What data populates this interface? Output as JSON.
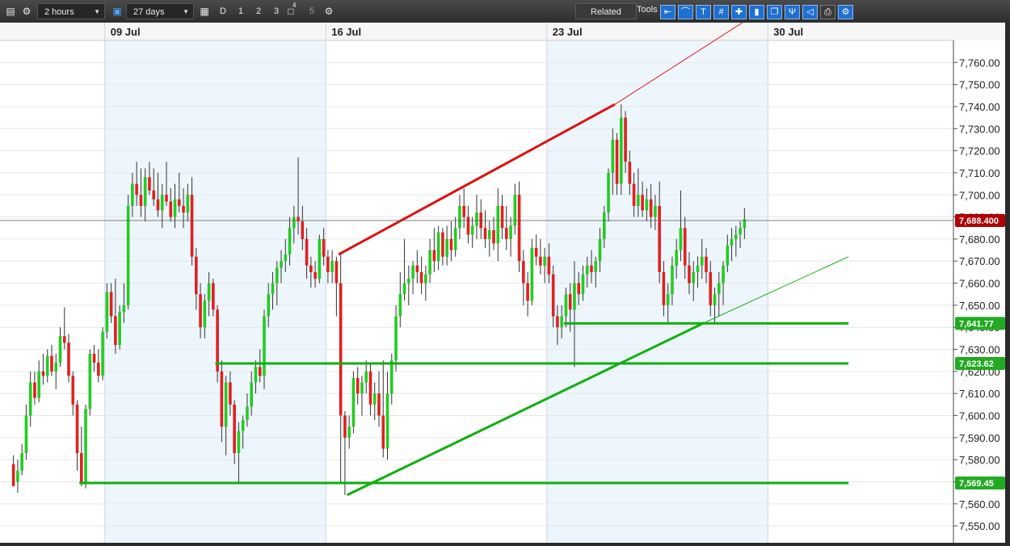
{
  "toolbar": {
    "interval": "2 hours",
    "range": "27 days",
    "period_buttons": [
      "D",
      "1",
      "2",
      "3"
    ],
    "badge": "4",
    "period_extra": "5",
    "related_label": "Related",
    "tools_label": "Tools",
    "icons": [
      "list-icon",
      "gear-icon",
      "lock-icon",
      "calendar-icon",
      "layers-icon",
      "settings-icon"
    ],
    "tool_icons": [
      "arrow-left-icon",
      "curve-icon",
      "text-icon",
      "grid-icon",
      "crosshair-icon",
      "candle-icon",
      "copy-icon",
      "pitchfork-icon",
      "label-icon",
      "print-icon",
      "settings-link-icon"
    ]
  },
  "chart_data": {
    "type": "candlestick",
    "ylim": [
      7542,
      7770
    ],
    "x_range_bars": [
      0,
      192
    ],
    "date_labels": [
      {
        "bar": 22,
        "label": "09 Jul"
      },
      {
        "bar": 74,
        "label": "16 Jul"
      },
      {
        "bar": 126,
        "label": "23 Jul"
      },
      {
        "bar": 178,
        "label": "30 Jul"
      }
    ],
    "y_ticks": [
      7550,
      7560,
      7570,
      7580,
      7590,
      7600,
      7610,
      7620,
      7630,
      7640,
      7650,
      7660,
      7670,
      7680,
      7690,
      7700,
      7710,
      7720,
      7730,
      7740,
      7750,
      7760
    ],
    "price_tags": [
      {
        "value": 7688.4,
        "label": "7,688.400",
        "color": "#b00000"
      },
      {
        "value": 7641.77,
        "label": "7,641.77",
        "color": "#22aa22"
      },
      {
        "value": 7623.62,
        "label": "7,623.62",
        "color": "#22aa22"
      },
      {
        "value": 7569.45,
        "label": "7,569.45",
        "color": "#22aa22"
      }
    ],
    "trendlines": [
      {
        "color": "#e01010",
        "from": [
          77,
          7673
        ],
        "to": [
          142,
          7741
        ],
        "extend_to": [
          172,
          7778
        ]
      },
      {
        "color": "#10b010",
        "from": [
          79,
          7564
        ],
        "to": [
          163,
          7642
        ],
        "extend_to": [
          197,
          7672
        ]
      },
      {
        "color": "#10b010",
        "from": [
          16,
          7569.45
        ],
        "to": [
          197,
          7569.45
        ]
      },
      {
        "color": "#10b010",
        "from": [
          48,
          7623.62
        ],
        "to": [
          197,
          7623.62
        ]
      },
      {
        "color": "#10b010",
        "from": [
          130,
          7641.77
        ],
        "to": [
          197,
          7641.77
        ]
      }
    ],
    "colors": {
      "up": "#22cc22",
      "down": "#e02020",
      "shade": "#eef6fd"
    },
    "candles": [
      [
        7578,
        7582,
        7570,
        7568
      ],
      [
        7570,
        7580,
        7565,
        7575
      ],
      [
        7575,
        7587,
        7573,
        7583
      ],
      [
        7583,
        7605,
        7580,
        7600
      ],
      [
        7600,
        7620,
        7595,
        7615
      ],
      [
        7615,
        7620,
        7605,
        7608
      ],
      [
        7608,
        7625,
        7606,
        7620
      ],
      [
        7620,
        7628,
        7614,
        7618
      ],
      [
        7618,
        7630,
        7615,
        7627
      ],
      [
        7627,
        7632,
        7618,
        7620
      ],
      [
        7620,
        7628,
        7612,
        7624
      ],
      [
        7624,
        7640,
        7622,
        7636
      ],
      [
        7636,
        7649,
        7630,
        7633
      ],
      [
        7633,
        7637,
        7615,
        7618
      ],
      [
        7618,
        7620,
        7600,
        7605
      ],
      [
        7605,
        7607,
        7575,
        7583
      ],
      [
        7583,
        7595,
        7568,
        7570
      ],
      [
        7570,
        7605,
        7567,
        7603
      ],
      [
        7603,
        7630,
        7600,
        7628
      ],
      [
        7628,
        7632,
        7620,
        7624
      ],
      [
        7624,
        7630,
        7615,
        7618
      ],
      [
        7618,
        7640,
        7616,
        7638
      ],
      [
        7638,
        7660,
        7635,
        7656
      ],
      [
        7656,
        7660,
        7642,
        7645
      ],
      [
        7645,
        7662,
        7628,
        7632
      ],
      [
        7632,
        7650,
        7630,
        7647
      ],
      [
        7647,
        7660,
        7642,
        7650
      ],
      [
        7650,
        7700,
        7648,
        7695
      ],
      [
        7695,
        7710,
        7690,
        7705
      ],
      [
        7705,
        7715,
        7695,
        7700
      ],
      [
        7700,
        7712,
        7690,
        7695
      ],
      [
        7695,
        7712,
        7688,
        7708
      ],
      [
        7708,
        7715,
        7700,
        7702
      ],
      [
        7702,
        7712,
        7695,
        7698
      ],
      [
        7698,
        7710,
        7690,
        7693
      ],
      [
        7693,
        7705,
        7685,
        7700
      ],
      [
        7700,
        7715,
        7695,
        7697
      ],
      [
        7697,
        7703,
        7688,
        7690
      ],
      [
        7690,
        7705,
        7685,
        7698
      ],
      [
        7698,
        7710,
        7692,
        7695
      ],
      [
        7695,
        7703,
        7685,
        7692
      ],
      [
        7692,
        7705,
        7688,
        7700
      ],
      [
        7700,
        7708,
        7668,
        7672
      ],
      [
        7672,
        7676,
        7648,
        7655
      ],
      [
        7655,
        7660,
        7635,
        7640
      ],
      [
        7640,
        7655,
        7635,
        7652
      ],
      [
        7652,
        7665,
        7645,
        7660
      ],
      [
        7660,
        7662,
        7645,
        7648
      ],
      [
        7648,
        7650,
        7615,
        7620
      ],
      [
        7620,
        7625,
        7588,
        7595
      ],
      [
        7595,
        7618,
        7582,
        7615
      ],
      [
        7615,
        7620,
        7600,
        7605
      ],
      [
        7605,
        7607,
        7578,
        7583
      ],
      [
        7583,
        7597,
        7569,
        7593
      ],
      [
        7593,
        7600,
        7585,
        7598
      ],
      [
        7598,
        7610,
        7595,
        7604
      ],
      [
        7604,
        7620,
        7600,
        7615
      ],
      [
        7615,
        7625,
        7610,
        7622
      ],
      [
        7622,
        7630,
        7615,
        7618
      ],
      [
        7618,
        7648,
        7612,
        7645
      ],
      [
        7645,
        7660,
        7640,
        7655
      ],
      [
        7655,
        7665,
        7648,
        7660
      ],
      [
        7660,
        7670,
        7650,
        7667
      ],
      [
        7667,
        7675,
        7660,
        7670
      ],
      [
        7670,
        7680,
        7665,
        7673
      ],
      [
        7673,
        7690,
        7668,
        7685
      ],
      [
        7685,
        7695,
        7678,
        7690
      ],
      [
        7690,
        7717,
        7682,
        7688
      ],
      [
        7688,
        7695,
        7675,
        7680
      ],
      [
        7680,
        7685,
        7662,
        7668
      ],
      [
        7668,
        7672,
        7658,
        7665
      ],
      [
        7665,
        7670,
        7658,
        7662
      ],
      [
        7662,
        7682,
        7660,
        7680
      ],
      [
        7680,
        7685,
        7668,
        7672
      ],
      [
        7672,
        7675,
        7660,
        7665
      ],
      [
        7665,
        7675,
        7660,
        7670
      ],
      [
        7670,
        7672,
        7645,
        7660
      ],
      [
        7660,
        7673,
        7570,
        7600
      ],
      [
        7600,
        7602,
        7564,
        7590
      ],
      [
        7590,
        7600,
        7585,
        7595
      ],
      [
        7595,
        7620,
        7592,
        7617
      ],
      [
        7617,
        7622,
        7605,
        7610
      ],
      [
        7610,
        7618,
        7600,
        7615
      ],
      [
        7615,
        7625,
        7610,
        7620
      ],
      [
        7620,
        7624,
        7600,
        7605
      ],
      [
        7605,
        7615,
        7598,
        7610
      ],
      [
        7610,
        7620,
        7595,
        7600
      ],
      [
        7600,
        7625,
        7581,
        7585
      ],
      [
        7585,
        7620,
        7580,
        7610
      ],
      [
        7610,
        7628,
        7605,
        7625
      ],
      [
        7625,
        7650,
        7620,
        7645
      ],
      [
        7645,
        7665,
        7640,
        7655
      ],
      [
        7655,
        7680,
        7652,
        7660
      ],
      [
        7660,
        7668,
        7650,
        7662
      ],
      [
        7662,
        7670,
        7655,
        7668
      ],
      [
        7668,
        7675,
        7660,
        7665
      ],
      [
        7665,
        7672,
        7655,
        7660
      ],
      [
        7660,
        7668,
        7652,
        7664
      ],
      [
        7664,
        7680,
        7660,
        7675
      ],
      [
        7675,
        7685,
        7665,
        7670
      ],
      [
        7670,
        7686,
        7666,
        7683
      ],
      [
        7683,
        7685,
        7668,
        7672
      ],
      [
        7672,
        7686,
        7668,
        7680
      ],
      [
        7680,
        7688,
        7670,
        7675
      ],
      [
        7675,
        7690,
        7672,
        7685
      ],
      [
        7685,
        7700,
        7680,
        7695
      ],
      [
        7695,
        7703,
        7685,
        7690
      ],
      [
        7690,
        7695,
        7678,
        7682
      ],
      [
        7682,
        7690,
        7676,
        7686
      ],
      [
        7686,
        7700,
        7680,
        7692
      ],
      [
        7692,
        7698,
        7680,
        7685
      ],
      [
        7685,
        7693,
        7676,
        7680
      ],
      [
        7680,
        7688,
        7672,
        7684
      ],
      [
        7684,
        7690,
        7675,
        7678
      ],
      [
        7678,
        7703,
        7670,
        7695
      ],
      [
        7695,
        7700,
        7680,
        7685
      ],
      [
        7685,
        7695,
        7675,
        7680
      ],
      [
        7680,
        7690,
        7672,
        7686
      ],
      [
        7686,
        7705,
        7682,
        7700
      ],
      [
        7700,
        7706,
        7665,
        7670
      ],
      [
        7670,
        7675,
        7650,
        7660
      ],
      [
        7660,
        7665,
        7645,
        7652
      ],
      [
        7652,
        7680,
        7650,
        7676
      ],
      [
        7676,
        7682,
        7668,
        7672
      ],
      [
        7672,
        7680,
        7664,
        7668
      ],
      [
        7668,
        7676,
        7660,
        7672
      ],
      [
        7672,
        7678,
        7660,
        7664
      ],
      [
        7664,
        7668,
        7640,
        7645
      ],
      [
        7645,
        7650,
        7632,
        7640
      ],
      [
        7640,
        7650,
        7635,
        7645
      ],
      [
        7645,
        7658,
        7640,
        7655
      ],
      [
        7655,
        7660,
        7638,
        7648
      ],
      [
        7648,
        7670,
        7622,
        7660
      ],
      [
        7660,
        7665,
        7650,
        7655
      ],
      [
        7655,
        7668,
        7652,
        7664
      ],
      [
        7664,
        7672,
        7658,
        7668
      ],
      [
        7668,
        7675,
        7660,
        7665
      ],
      [
        7665,
        7672,
        7658,
        7670
      ],
      [
        7670,
        7685,
        7665,
        7680
      ],
      [
        7680,
        7695,
        7676,
        7692
      ],
      [
        7692,
        7712,
        7688,
        7710
      ],
      [
        7710,
        7730,
        7700,
        7725
      ],
      [
        7725,
        7728,
        7700,
        7705
      ],
      [
        7705,
        7741,
        7700,
        7735
      ],
      [
        7735,
        7738,
        7710,
        7715
      ],
      [
        7715,
        7720,
        7700,
        7705
      ],
      [
        7705,
        7710,
        7690,
        7695
      ],
      [
        7695,
        7712,
        7690,
        7700
      ],
      [
        7700,
        7706,
        7690,
        7693
      ],
      [
        7693,
        7703,
        7688,
        7698
      ],
      [
        7698,
        7705,
        7685,
        7690
      ],
      [
        7690,
        7700,
        7684,
        7695
      ],
      [
        7695,
        7706,
        7660,
        7665
      ],
      [
        7665,
        7670,
        7645,
        7650
      ],
      [
        7650,
        7660,
        7642,
        7655
      ],
      [
        7655,
        7672,
        7650,
        7668
      ],
      [
        7668,
        7680,
        7662,
        7675
      ],
      [
        7675,
        7702,
        7670,
        7685
      ],
      [
        7685,
        7690,
        7662,
        7668
      ],
      [
        7668,
        7674,
        7655,
        7660
      ],
      [
        7660,
        7670,
        7652,
        7665
      ],
      [
        7665,
        7672,
        7658,
        7668
      ],
      [
        7668,
        7680,
        7662,
        7672
      ],
      [
        7672,
        7676,
        7660,
        7665
      ],
      [
        7665,
        7670,
        7645,
        7650
      ],
      [
        7650,
        7658,
        7642,
        7655
      ],
      [
        7655,
        7665,
        7645,
        7660
      ],
      [
        7660,
        7670,
        7650,
        7668
      ],
      [
        7668,
        7682,
        7665,
        7677
      ],
      [
        7677,
        7685,
        7670,
        7680
      ],
      [
        7680,
        7686,
        7672,
        7682
      ],
      [
        7682,
        7688,
        7676,
        7685
      ],
      [
        7685,
        7694,
        7680,
        7689
      ]
    ]
  }
}
